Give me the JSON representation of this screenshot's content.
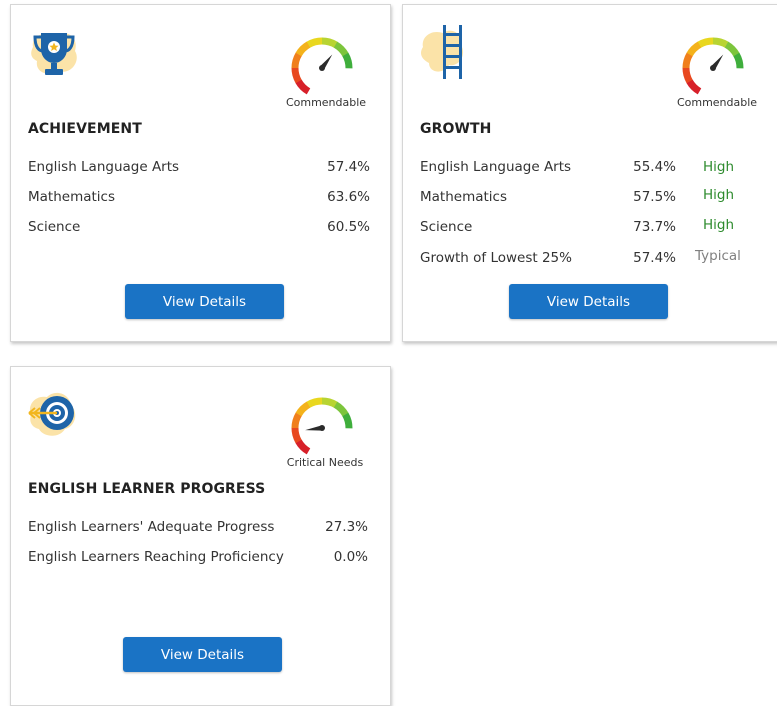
{
  "colors": {
    "button": "#1a73c5",
    "rating_high": "#2e8b2e",
    "rating_typical": "#808080",
    "icon_blue": "#1e64a8",
    "icon_blob": "#fbe3a8"
  },
  "cards": [
    {
      "id": "achievement",
      "icon": "trophy-icon",
      "gauge": {
        "label": "Commendable",
        "level": 0.78
      },
      "title": "ACHIEVEMENT",
      "rows": [
        {
          "label": "English Language Arts",
          "value": "57.4%"
        },
        {
          "label": "Mathematics",
          "value": "63.6%"
        },
        {
          "label": "Science",
          "value": "60.5%"
        }
      ],
      "button": "View Details"
    },
    {
      "id": "growth",
      "icon": "ladder-icon",
      "gauge": {
        "label": "Commendable",
        "level": 0.78
      },
      "title": "GROWTH",
      "rows": [
        {
          "label": "English Language Arts",
          "value": "55.4%",
          "rating": "High"
        },
        {
          "label": "Mathematics",
          "value": "57.5%",
          "rating": "High"
        },
        {
          "label": "Science",
          "value": "73.7%",
          "rating": "High"
        },
        {
          "label": "Growth of Lowest 25%",
          "value": "57.4%",
          "rating": "Typical"
        }
      ],
      "button": "View Details"
    },
    {
      "id": "english-learner-progress",
      "icon": "target-icon",
      "gauge": {
        "label": "Critical Needs",
        "level": 0.22
      },
      "title": "ENGLISH LEARNER PROGRESS",
      "rows": [
        {
          "label": "English Learners' Adequate Progress",
          "value": "27.3%"
        },
        {
          "label": "English Learners Reaching Proficiency",
          "value": "0.0%"
        }
      ],
      "button": "View Details"
    }
  ]
}
